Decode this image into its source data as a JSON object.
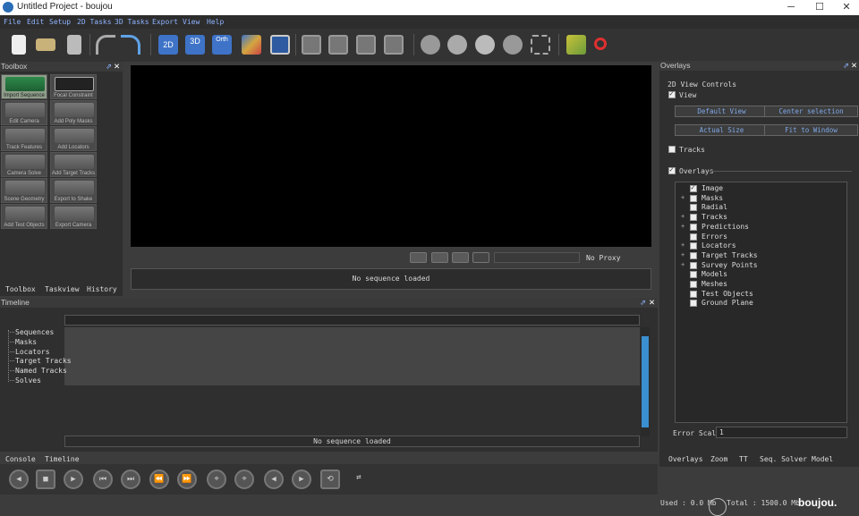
{
  "window": {
    "title": "Untitled Project - boujou",
    "min": "─",
    "max": "☐",
    "close": "✕"
  },
  "menu": [
    "File",
    "Edit",
    "Setup",
    "2D Tasks",
    "3D Tasks",
    "Export",
    "View",
    "Help"
  ],
  "toolbar_icons": [
    "new-file-icon",
    "open-folder-icon",
    "save-icon",
    "undo-icon",
    "redo-icon",
    "view-2d-icon",
    "view-3d-icon",
    "view-orth-icon",
    "view-graph-icon",
    "view-grid-icon",
    "layout-single-icon",
    "layout-split-icon",
    "layout-stack-icon",
    "layout-quad-icon",
    "camera-track-icon",
    "camera-solve-icon",
    "camera-reel-icon",
    "camera-orbit-icon",
    "frame-icon",
    "tracks-tool-icon",
    "find-icon"
  ],
  "toolbar_labels": {
    "v2d": "2D",
    "v3d": "3D",
    "orth": "Orth"
  },
  "toolbox": {
    "title": "Toolbox",
    "tools": [
      "Import Sequence",
      "Focal Constraint",
      "Edit Camera",
      "Add Poly Masks",
      "Track Features",
      "Add Locators",
      "Camera Solve",
      "Add Target Tracks",
      "Scene Geometry",
      "Export to Shake",
      "Add Test Objects",
      "Export Camera"
    ],
    "tabs": [
      "Toolbox",
      "Taskview",
      "History"
    ]
  },
  "viewer": {
    "proxy": "No Proxy",
    "status": "No sequence loaded"
  },
  "timeline": {
    "title": "Timeline",
    "items": [
      "Sequences",
      "Masks",
      "Locators",
      "Target Tracks",
      "Named Tracks",
      "Solves"
    ],
    "status": "No sequence loaded",
    "tabs": [
      "Console",
      "Timeline"
    ]
  },
  "overlays": {
    "title": "Overlays",
    "section": "2D View Controls",
    "view_label": "View",
    "buttons": [
      "Default View",
      "Center selection",
      "Actual Size",
      "Fit to Window"
    ],
    "tracks_label": "Tracks",
    "overlays_label": "Overlays",
    "items": [
      "Image",
      "Masks",
      "Radial",
      "Tracks",
      "Predictions",
      "Errors",
      "Locators",
      "Target Tracks",
      "Survey Points",
      "Models",
      "Meshes",
      "Test Objects",
      "Ground Plane"
    ],
    "expandable": [
      false,
      true,
      false,
      true,
      true,
      false,
      true,
      true,
      true,
      false,
      false,
      false,
      false
    ],
    "checked": [
      true,
      false,
      false,
      false,
      false,
      false,
      false,
      false,
      false,
      false,
      false,
      false,
      false
    ],
    "error_scale_label": "Error Scale",
    "error_scale_value": "1",
    "tabs": [
      "Overlays",
      "Zoom",
      "TT",
      "Seq. Solver",
      "Model"
    ]
  },
  "status": {
    "used": "Used : 0.0 Mb",
    "total": "Total : 1500.0 Mb",
    "brand": "boujou."
  },
  "colors": {
    "accent": "#8fb3ff",
    "button_text": "#7fa8e8",
    "viewport": "#000000"
  }
}
